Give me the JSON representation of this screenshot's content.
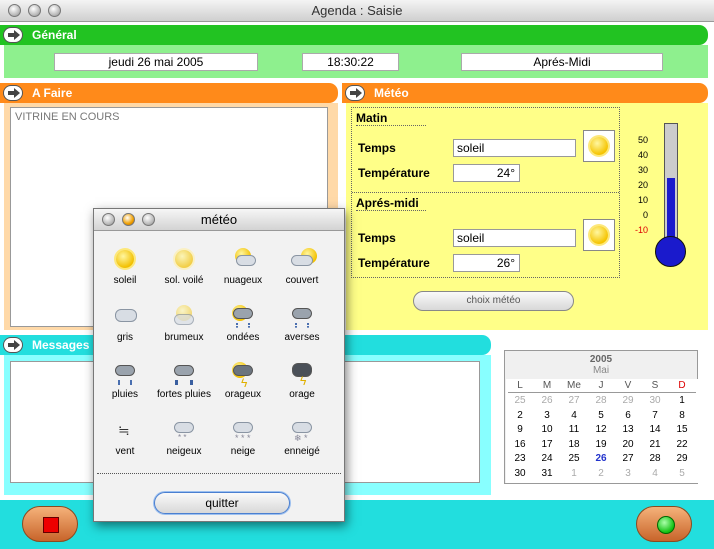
{
  "window": {
    "title": "Agenda : Saisie"
  },
  "general": {
    "header": "Général",
    "date": "jeudi 26 mai 2005",
    "time": "18:30:22",
    "period": "Aprés-Midi"
  },
  "afaire": {
    "header": "A Faire",
    "text": "VITRINE EN COURS"
  },
  "messages": {
    "header": "Messages"
  },
  "meteo": {
    "header": "Météo",
    "matin": {
      "title": "Matin",
      "temps_label": "Temps",
      "temps_value": "soleil",
      "temp_label": "Température",
      "temp_value": "24°"
    },
    "apresmidi": {
      "title": "Aprés-midi",
      "temps_label": "Temps",
      "temps_value": "soleil",
      "temp_label": "Température",
      "temp_value": "26°"
    },
    "choix_button": "choix météo",
    "scale": [
      "50",
      "40",
      "30",
      "20",
      "10",
      "0",
      "-10"
    ],
    "thermo_level": 0.55
  },
  "calendar": {
    "year": "2005",
    "month": "Mai",
    "weekdays": [
      "L",
      "M",
      "Me",
      "J",
      "V",
      "S",
      "D"
    ],
    "rows": [
      [
        "25",
        "26",
        "27",
        "28",
        "29",
        "30",
        "1"
      ],
      [
        "2",
        "3",
        "4",
        "5",
        "6",
        "7",
        "8"
      ],
      [
        "9",
        "10",
        "11",
        "12",
        "13",
        "14",
        "15"
      ],
      [
        "16",
        "17",
        "18",
        "19",
        "20",
        "21",
        "22"
      ],
      [
        "23",
        "24",
        "25",
        "26",
        "27",
        "28",
        "29"
      ],
      [
        "30",
        "31",
        "1",
        "2",
        "3",
        "4",
        "5"
      ]
    ],
    "today": "26"
  },
  "popup": {
    "title": "météo",
    "items": [
      "soleil",
      "sol. voilé",
      "nuageux",
      "couvert",
      "gris",
      "brumeux",
      "ondées",
      "averses",
      "pluies",
      "fortes pluies",
      "orageux",
      "orage",
      "vent",
      "neigeux",
      "neige",
      "enneigé"
    ],
    "quit_button": "quitter"
  },
  "colors": {
    "green": "#22c322",
    "green_light": "#8ef08e",
    "orange": "#ff8a1a",
    "orange_light": "#ffd9a8",
    "yellow": "#ffff88",
    "cyan": "#22dede",
    "cyan_light": "#88ffff"
  }
}
